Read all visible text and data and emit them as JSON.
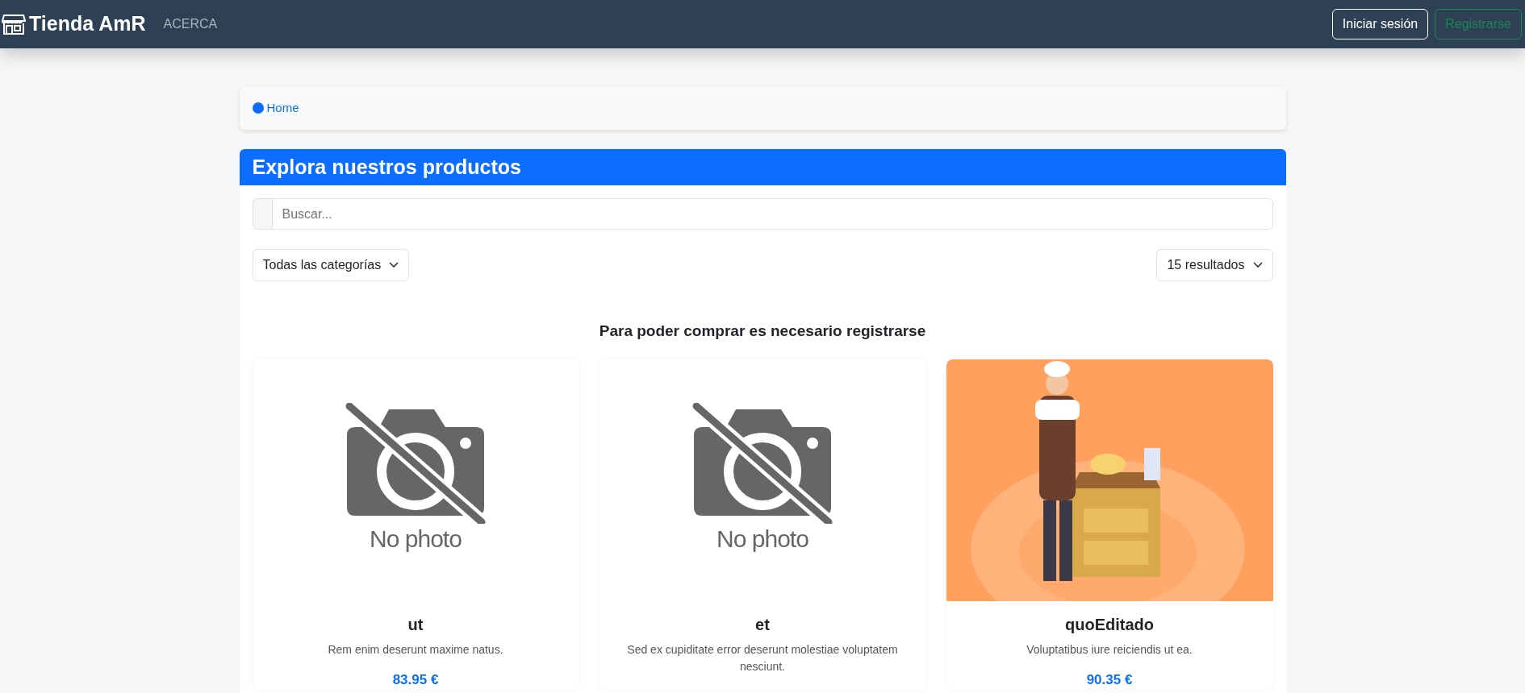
{
  "navbar": {
    "brand": "Tienda AmR",
    "links": [
      "ACERCA"
    ],
    "buttons": [
      {
        "label": "Iniciar sesión",
        "kind": "outline-light"
      },
      {
        "label": "Registrarse",
        "kind": "outline-success"
      }
    ]
  },
  "breadcrumb": [
    {
      "label": "Home"
    }
  ],
  "panel": {
    "title": "Explora nuestros productos",
    "search": {
      "placeholder": "Buscar..."
    },
    "category_filter": "Todas las categorías",
    "results_filter": "15 resultados",
    "notice": "Para poder comprar es necesario registrarse"
  },
  "products": [
    {
      "name": "ut",
      "description": "Rem enim deserunt maxime natus.",
      "price": "83.95 €",
      "image": {
        "kind": "placeholder",
        "text": "No photo"
      }
    },
    {
      "name": "et",
      "description": "Sed ex cupiditate error deserunt molestiae voluptatem nesciunt.",
      "image": {
        "kind": "placeholder",
        "text": "No photo"
      }
    },
    {
      "name": "quoEditado",
      "description": "Voluptatibus iure reiciendis ut ea.",
      "price": "90.35 €"
    }
  ]
}
